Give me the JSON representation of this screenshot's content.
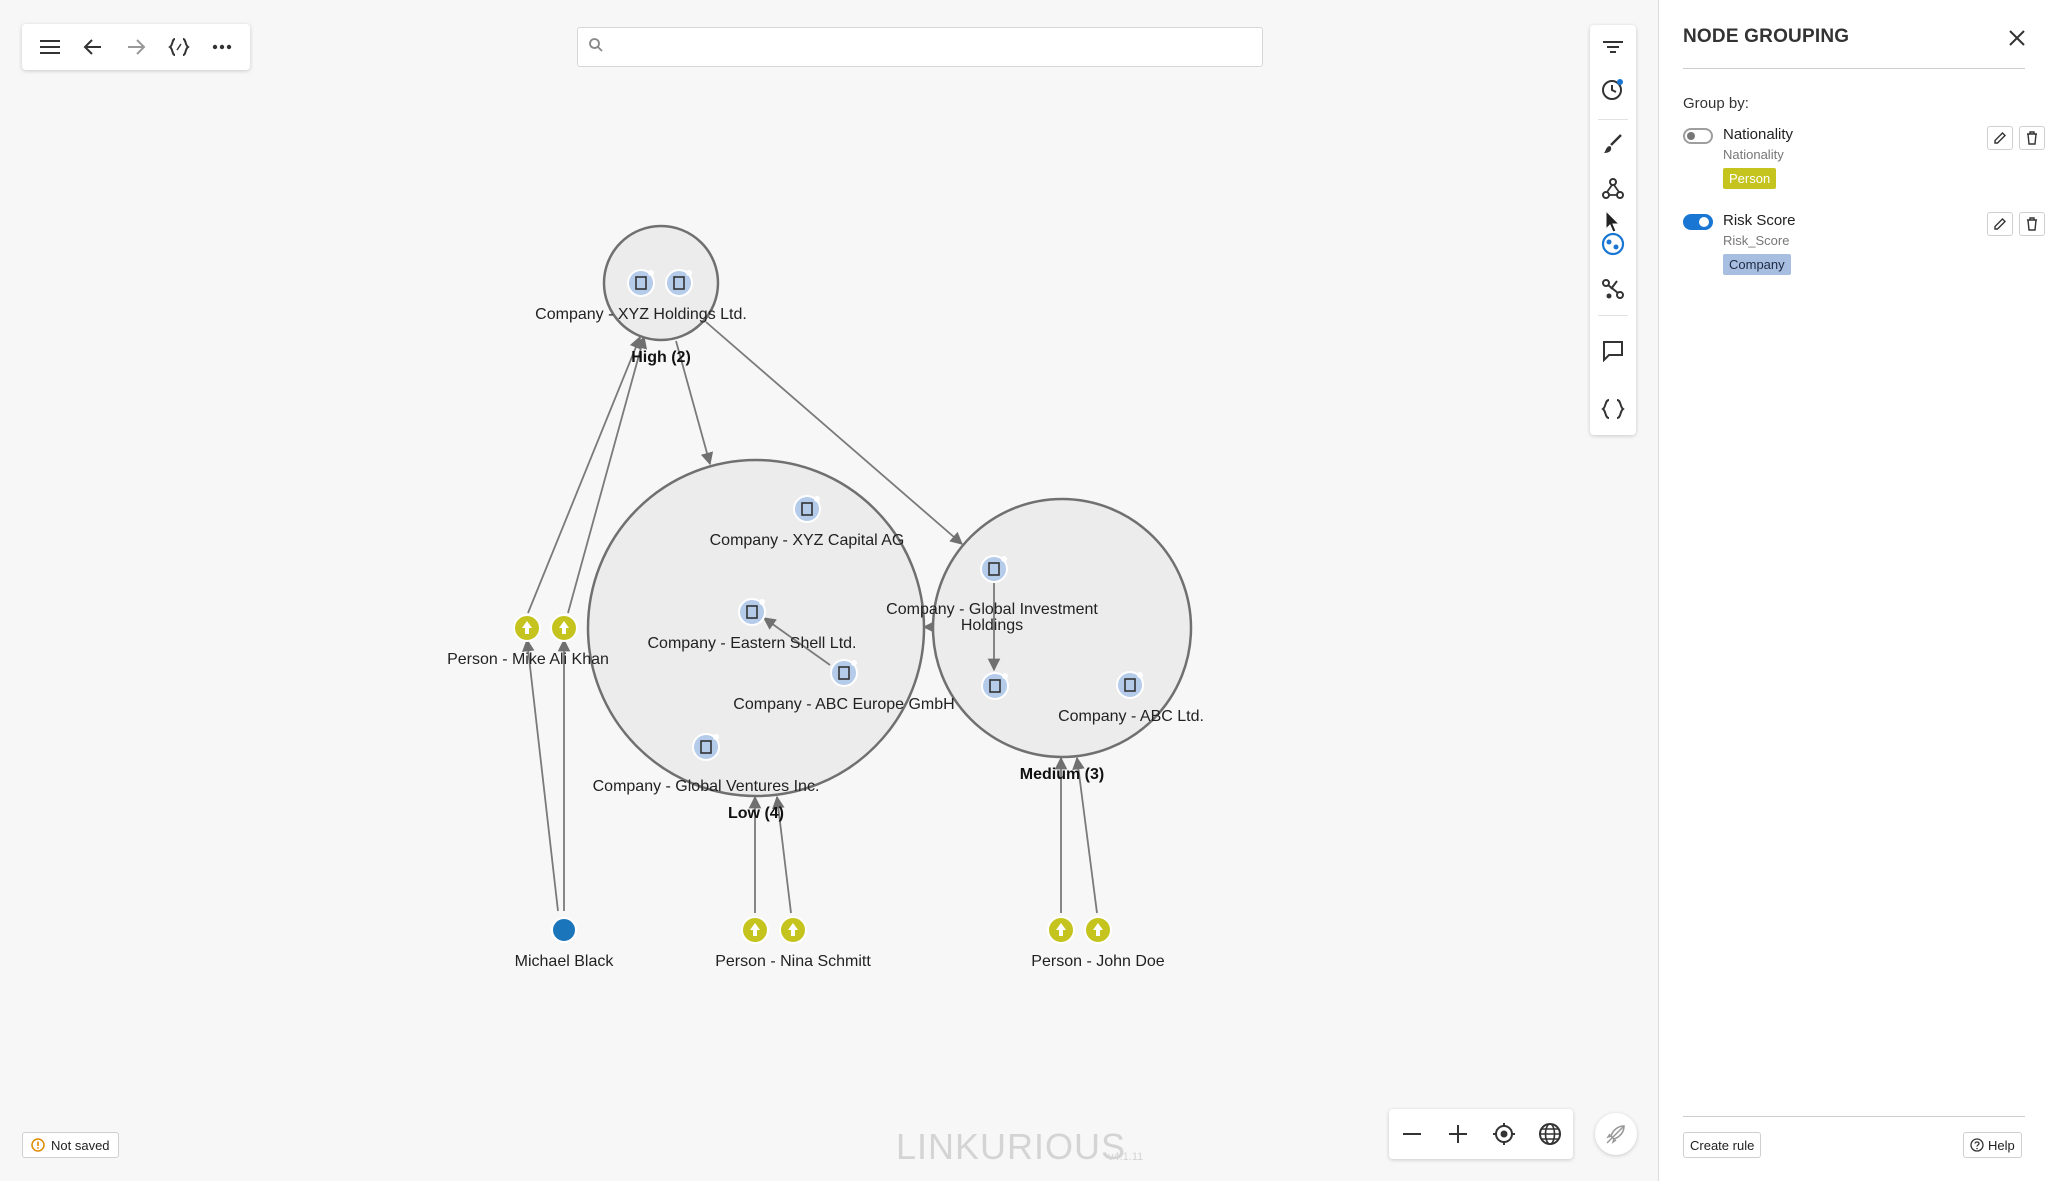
{
  "search": {
    "placeholder": ""
  },
  "panel": {
    "title": "NODE GROUPING",
    "group_by_label": "Group by:",
    "rules": [
      {
        "name": "Nationality",
        "property": "Nationality",
        "category": "Person",
        "enabled": false,
        "badge_color": "#c5c41f"
      },
      {
        "name": "Risk Score",
        "property": "Risk_Score",
        "category": "Company",
        "enabled": true,
        "badge_color": "#a7bee0"
      }
    ],
    "create_rule_label": "Create rule",
    "help_label": "Help"
  },
  "status": {
    "not_saved": "Not saved"
  },
  "watermark": {
    "brand": "LINKURIOUS",
    "version": "v4.1.11"
  },
  "graph": {
    "groups": [
      {
        "id": "high",
        "label": "High (2)"
      },
      {
        "id": "low",
        "label": "Low (4)"
      },
      {
        "id": "medium",
        "label": "Medium (3)"
      }
    ],
    "company_labels": {
      "xyz_holdings": "Company - XYZ Holdings Ltd.",
      "xyz_capital": "Company - XYZ Capital AG",
      "eastern_shell": "Company - Eastern Shell Ltd.",
      "abc_europe": "Company - ABC Europe GmbH",
      "global_ventures": "Company - Global Ventures Inc.",
      "global_investment_1": "Company - Global Investment",
      "global_investment_2": "Holdings",
      "abc_ltd": "Company - ABC Ltd."
    },
    "person_labels": {
      "mike": "Person - Mike Ali Khan",
      "nina": "Person - Nina Schmitt",
      "john": "Person - John Doe",
      "michael": "Michael Black"
    },
    "colors": {
      "person": "#c5c41f",
      "company_fill": "#b4cbea",
      "group_fill": "#ececec",
      "group_stroke": "#707070",
      "michael": "#1b75bb",
      "accent": "#1976d2"
    }
  },
  "icons": {
    "toolbar": [
      "menu-icon",
      "back-arrow-icon",
      "forward-arrow-icon",
      "code-braces-icon",
      "more-icon"
    ],
    "side": [
      "filter-icon",
      "history-icon",
      "brush-icon",
      "node-graph-icon",
      "grouping-icon",
      "shortest-path-icon",
      "comment-icon",
      "query-icon"
    ],
    "zoom": [
      "zoom-out-icon",
      "zoom-in-icon",
      "locate-icon",
      "globe-icon"
    ]
  }
}
